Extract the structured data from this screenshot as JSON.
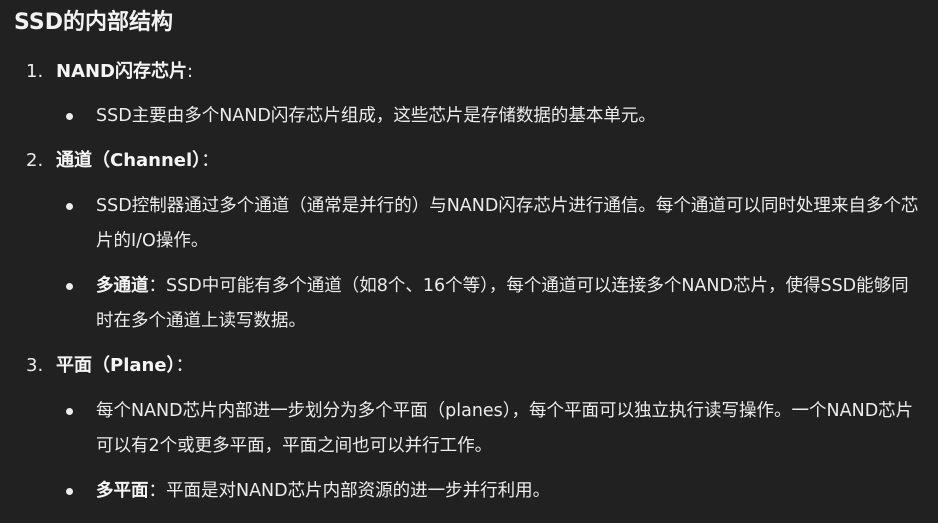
{
  "title": "SSD的内部结构",
  "sections": [
    {
      "number": "1.",
      "heading": "NAND闪存芯片",
      "heading_suffix": ":",
      "bullets": [
        {
          "bold": "",
          "text": "SSD主要由多个NAND闪存芯片组成，这些芯片是存储数据的基本单元。"
        }
      ]
    },
    {
      "number": "2.",
      "heading": "通道（Channel）",
      "heading_suffix": "：",
      "bullets": [
        {
          "bold": "",
          "text": "SSD控制器通过多个通道（通常是并行的）与NAND闪存芯片进行通信。每个通道可以同时处理来自多个芯片的I/O操作。"
        },
        {
          "bold": "多通道",
          "text": "：SSD中可能有多个通道（如8个、16个等），每个通道可以连接多个NAND芯片，使得SSD能够同时在多个通道上读写数据。"
        }
      ]
    },
    {
      "number": "3.",
      "heading": "平面（Plane）",
      "heading_suffix": "：",
      "bullets": [
        {
          "bold": "",
          "text": "每个NAND芯片内部进一步划分为多个平面（planes），每个平面可以独立执行读写操作。一个NAND芯片可以有2个或更多平面，平面之间也可以并行工作。"
        },
        {
          "bold": "多平面",
          "text": "：平面是对NAND芯片内部资源的进一步并行利用。"
        }
      ]
    }
  ]
}
